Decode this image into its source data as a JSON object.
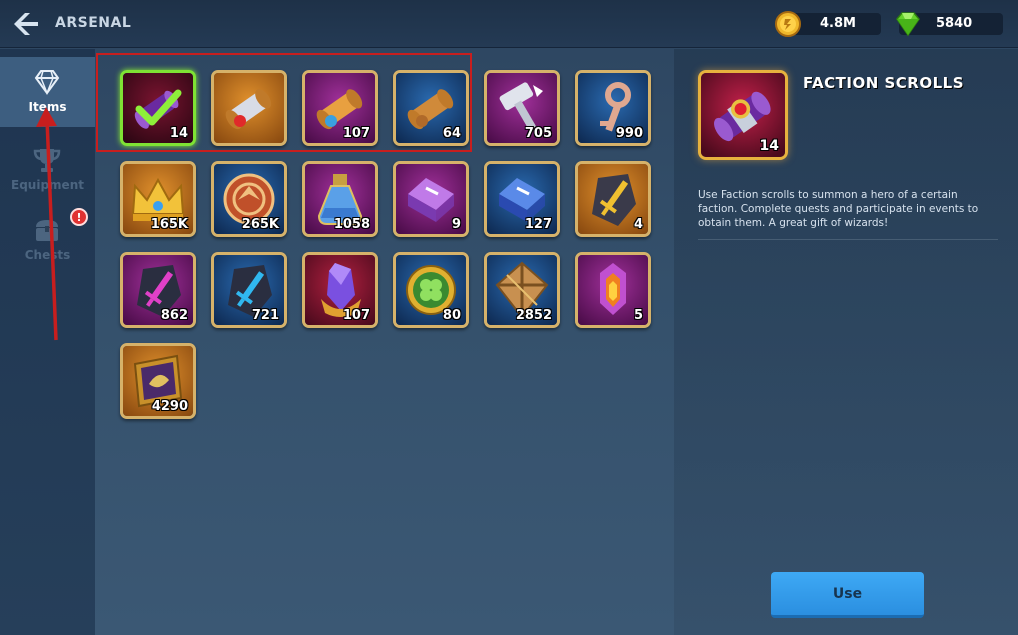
{
  "header": {
    "title": "ARSENAL",
    "gold": "4.8M",
    "gems": "5840"
  },
  "sidebar": {
    "items": [
      {
        "label": "Items",
        "icon": "diamond-icon",
        "active": true
      },
      {
        "label": "Equipment",
        "icon": "trophy-icon",
        "active": false
      },
      {
        "label": "Chests",
        "icon": "chest-icon",
        "active": false,
        "badge": "!"
      }
    ]
  },
  "grid": {
    "items": [
      {
        "name": "Faction scroll (selected)",
        "icon": "scroll-check-icon",
        "count": "14",
        "selected": true
      },
      {
        "name": "Orange scroll",
        "icon": "scroll-icon",
        "count": ""
      },
      {
        "name": "Scroll",
        "icon": "scroll-icon",
        "count": "107"
      },
      {
        "name": "Scroll",
        "icon": "scroll-icon",
        "count": "64"
      },
      {
        "name": "Hammer",
        "icon": "hammer-icon",
        "count": "705"
      },
      {
        "name": "Key",
        "icon": "key-icon",
        "count": "990"
      },
      {
        "name": "Crown",
        "icon": "crown-icon",
        "count": "165K"
      },
      {
        "name": "Coin token",
        "icon": "coin-token-icon",
        "count": "265K"
      },
      {
        "name": "Potion",
        "icon": "potion-icon",
        "count": "1058"
      },
      {
        "name": "Purple ingot",
        "icon": "ingot-icon",
        "count": "9"
      },
      {
        "name": "Blue ingot",
        "icon": "ingot-icon",
        "count": "127"
      },
      {
        "name": "Gold sword stone",
        "icon": "sword-stone-icon",
        "count": "4"
      },
      {
        "name": "Purple sword stone",
        "icon": "sword-stone-icon",
        "count": "862"
      },
      {
        "name": "Blue sword stone",
        "icon": "sword-stone-icon",
        "count": "721"
      },
      {
        "name": "Crystal shard",
        "icon": "crystal-icon",
        "count": "107"
      },
      {
        "name": "Clover coin",
        "icon": "clover-coin-icon",
        "count": "80"
      },
      {
        "name": "Wooden box",
        "icon": "box-icon",
        "count": "2852"
      },
      {
        "name": "Fire crystal",
        "icon": "fire-crystal-icon",
        "count": "5"
      },
      {
        "name": "Golden card",
        "icon": "card-icon",
        "count": "4290"
      }
    ]
  },
  "detail": {
    "title": "FACTION SCROLLS",
    "count": "14",
    "description": "Use Faction scrolls to summon a hero of a certain faction. Complete quests and participate in events to obtain them. A great gift of wizards!",
    "use_label": "Use"
  },
  "colors": {
    "accent_gold": "#d6b26a",
    "selected_green": "#7ee234",
    "use_button": "#3ea9f5",
    "highlight_red": "#c81e1e"
  }
}
